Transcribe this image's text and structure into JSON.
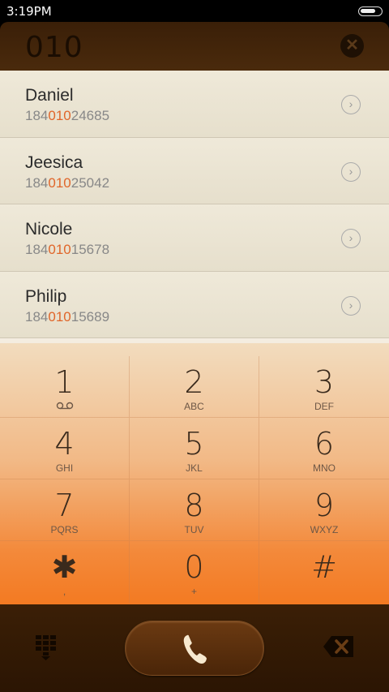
{
  "status": {
    "time": "3:19PM",
    "battery_level": 0.8
  },
  "dialer": {
    "number": "010",
    "clear_icon": "clear-icon"
  },
  "results": [
    {
      "name": "Daniel",
      "prefix": "184",
      "match": "010",
      "suffix": "24685"
    },
    {
      "name": "Jeesica",
      "prefix": "184",
      "match": "010",
      "suffix": "25042"
    },
    {
      "name": "Nicole",
      "prefix": "184",
      "match": "010",
      "suffix": "15678"
    },
    {
      "name": "Philip",
      "prefix": "184",
      "match": "010",
      "suffix": "15689"
    }
  ],
  "keys": [
    {
      "digit": "1",
      "letters": "ꝏ"
    },
    {
      "digit": "2",
      "letters": "ABC"
    },
    {
      "digit": "3",
      "letters": "DEF"
    },
    {
      "digit": "4",
      "letters": "GHI"
    },
    {
      "digit": "5",
      "letters": "JKL"
    },
    {
      "digit": "6",
      "letters": "MNO"
    },
    {
      "digit": "7",
      "letters": "PQRS"
    },
    {
      "digit": "8",
      "letters": "TUV"
    },
    {
      "digit": "9",
      "letters": "WXYZ"
    },
    {
      "digit": "✱",
      "letters": ","
    },
    {
      "digit": "0",
      "letters": "+"
    },
    {
      "digit": "#",
      "letters": ""
    }
  ],
  "colors": {
    "highlight": "#e0662a",
    "keypad_top": "#f2dcbe",
    "keypad_bottom": "#f37a22",
    "header": "#3a1f08"
  }
}
